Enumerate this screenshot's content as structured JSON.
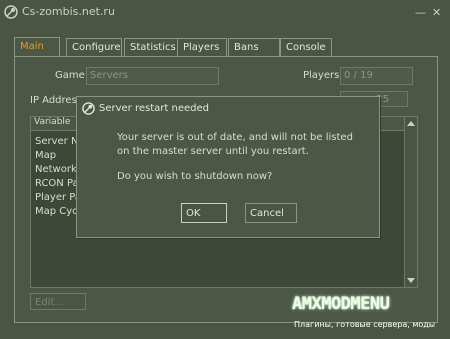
{
  "window": {
    "title": "Cs-zombis.net.ru",
    "minimize_icon": "minimize-icon",
    "close_icon": "close-icon"
  },
  "tabs": [
    {
      "label": "Main",
      "active": true
    },
    {
      "label": "Configure"
    },
    {
      "label": "Statistics"
    },
    {
      "label": "Players"
    },
    {
      "label": "Bans"
    },
    {
      "label": "Console"
    }
  ],
  "main": {
    "game_label": "Game",
    "game_value": "Servers",
    "players_label": "Players",
    "players_value": "0 / 19",
    "ip_label": "IP Addres",
    "ip_value_tail": "25",
    "list_header": "Variable",
    "variables": [
      "Server N",
      "Map",
      "Network",
      "RCON Pa",
      "Player Pa",
      "Map Cycl"
    ],
    "edit_label": "Edit..."
  },
  "dialog": {
    "title": "Server restart needed",
    "line1": "Your server is out of date, and will not be listed",
    "line2": "on the master server until you restart.",
    "question": "Do you wish to shutdown now?",
    "ok_label": "OK",
    "cancel_label": "Cancel"
  },
  "watermark": {
    "text": "AMXMODMENU",
    "subtitle": "Плагины, готовые сервера, моды"
  },
  "colors": {
    "accent_tab": "#d8a030",
    "window_bg": "#4a5642"
  },
  "icons": {
    "title": "steam-icon",
    "dialog": "steam-icon"
  }
}
